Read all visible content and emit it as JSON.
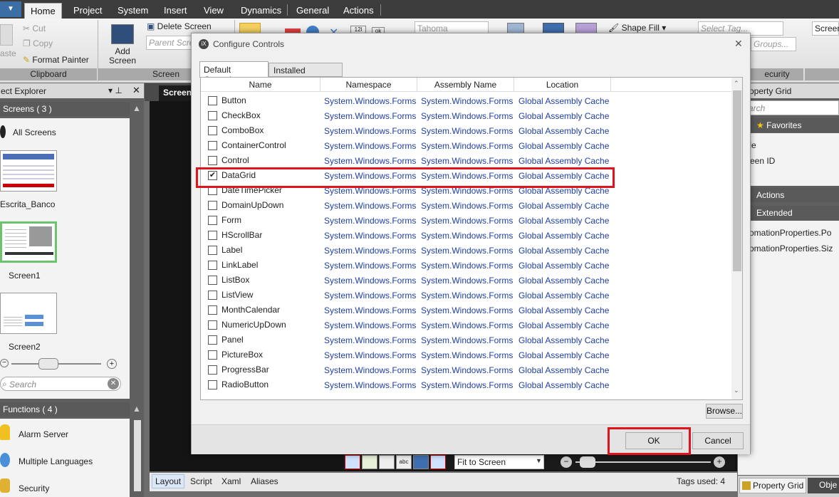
{
  "menubar": {
    "tabs": [
      "Home",
      "Project",
      "System",
      "Insert",
      "View",
      "Dynamics",
      "General",
      "Actions"
    ],
    "active": "Home"
  },
  "ribbon": {
    "clipboard": {
      "paste": "aste",
      "cut": "Cut",
      "copy": "Copy",
      "format_painter": "Format Painter",
      "group": "Clipboard"
    },
    "screen": {
      "add_screen": "Add Screen",
      "delete_screen": "Delete Screen",
      "parent_screen": "Parent Scre",
      "group": "Screen"
    },
    "font": "Tahoma",
    "shape_fill": "Shape Fill",
    "select_tag": "Select Tag...",
    "groups": "Groups...",
    "security_group": "ecurity",
    "screen_field": "Screen"
  },
  "object_explorer": {
    "title": "ect Explorer",
    "screens_header": "Screens ( 3 )",
    "all_screens": "All Screens",
    "screens": [
      "Escrita_Banco",
      "Screen1",
      "Screen2"
    ],
    "search_placeholder": "Search",
    "functions_header": "Functions ( 4 )",
    "functions": [
      "Alarm Server",
      "Multiple Languages",
      "Security"
    ]
  },
  "document": {
    "tab": "Screen",
    "zoom_option": "Fit to Screen",
    "bottom_tabs": [
      "Layout",
      "Script",
      "Xaml",
      "Aliases"
    ],
    "tags_used": "Tags used: 4"
  },
  "property_grid": {
    "title": "operty Grid",
    "search_placeholder": "arch",
    "favorites": "Favorites",
    "items": [
      "tle",
      "reen ID",
      "l"
    ],
    "actions": "Actions",
    "extended": "Extended",
    "extended_items": [
      "utomationProperties.Po",
      "utomationProperties.Siz"
    ],
    "bottom_tabs": [
      "Property Grid",
      "Obje"
    ]
  },
  "dialog": {
    "title": "Configure Controls",
    "close": "✕",
    "tabs": [
      "Default Controls",
      "Installed Controls"
    ],
    "columns": [
      "Name",
      "Namespace",
      "Assembly Name",
      "Location"
    ],
    "rows": [
      {
        "name": "Button",
        "checked": false,
        "ns": "System.Windows.Forms",
        "asm": "System.Windows.Forms",
        "loc": "Global Assembly Cache"
      },
      {
        "name": "CheckBox",
        "checked": false,
        "ns": "System.Windows.Forms",
        "asm": "System.Windows.Forms",
        "loc": "Global Assembly Cache"
      },
      {
        "name": "ComboBox",
        "checked": false,
        "ns": "System.Windows.Forms",
        "asm": "System.Windows.Forms",
        "loc": "Global Assembly Cache"
      },
      {
        "name": "ContainerControl",
        "checked": false,
        "ns": "System.Windows.Forms",
        "asm": "System.Windows.Forms",
        "loc": "Global Assembly Cache"
      },
      {
        "name": "Control",
        "checked": false,
        "ns": "System.Windows.Forms",
        "asm": "System.Windows.Forms",
        "loc": "Global Assembly Cache"
      },
      {
        "name": "DataGrid",
        "checked": true,
        "ns": "System.Windows.Forms",
        "asm": "System.Windows.Forms",
        "loc": "Global Assembly Cache"
      },
      {
        "name": "DateTimePicker",
        "checked": false,
        "ns": "System.Windows.Forms",
        "asm": "System.Windows.Forms",
        "loc": "Global Assembly Cache"
      },
      {
        "name": "DomainUpDown",
        "checked": false,
        "ns": "System.Windows.Forms",
        "asm": "System.Windows.Forms",
        "loc": "Global Assembly Cache"
      },
      {
        "name": "Form",
        "checked": false,
        "ns": "System.Windows.Forms",
        "asm": "System.Windows.Forms",
        "loc": "Global Assembly Cache"
      },
      {
        "name": "HScrollBar",
        "checked": false,
        "ns": "System.Windows.Forms",
        "asm": "System.Windows.Forms",
        "loc": "Global Assembly Cache"
      },
      {
        "name": "Label",
        "checked": false,
        "ns": "System.Windows.Forms",
        "asm": "System.Windows.Forms",
        "loc": "Global Assembly Cache"
      },
      {
        "name": "LinkLabel",
        "checked": false,
        "ns": "System.Windows.Forms",
        "asm": "System.Windows.Forms",
        "loc": "Global Assembly Cache"
      },
      {
        "name": "ListBox",
        "checked": false,
        "ns": "System.Windows.Forms",
        "asm": "System.Windows.Forms",
        "loc": "Global Assembly Cache"
      },
      {
        "name": "ListView",
        "checked": false,
        "ns": "System.Windows.Forms",
        "asm": "System.Windows.Forms",
        "loc": "Global Assembly Cache"
      },
      {
        "name": "MonthCalendar",
        "checked": false,
        "ns": "System.Windows.Forms",
        "asm": "System.Windows.Forms",
        "loc": "Global Assembly Cache"
      },
      {
        "name": "NumericUpDown",
        "checked": false,
        "ns": "System.Windows.Forms",
        "asm": "System.Windows.Forms",
        "loc": "Global Assembly Cache"
      },
      {
        "name": "Panel",
        "checked": false,
        "ns": "System.Windows.Forms",
        "asm": "System.Windows.Forms",
        "loc": "Global Assembly Cache"
      },
      {
        "name": "PictureBox",
        "checked": false,
        "ns": "System.Windows.Forms",
        "asm": "System.Windows.Forms",
        "loc": "Global Assembly Cache"
      },
      {
        "name": "ProgressBar",
        "checked": false,
        "ns": "System.Windows.Forms",
        "asm": "System.Windows.Forms",
        "loc": "Global Assembly Cache"
      },
      {
        "name": "RadioButton",
        "checked": false,
        "ns": "System.Windows.Forms",
        "asm": "System.Windows.Forms",
        "loc": "Global Assembly Cache"
      }
    ],
    "browse": "Browse...",
    "ok": "OK",
    "cancel": "Cancel"
  }
}
